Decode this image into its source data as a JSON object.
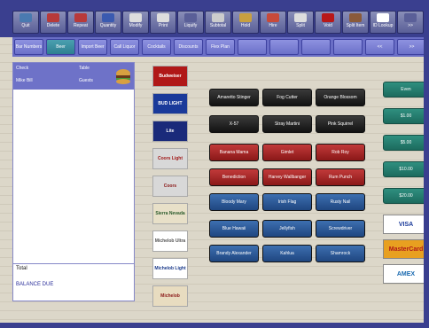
{
  "toolbar": {
    "items": [
      {
        "label": "Quit",
        "color": "#4a7ab0"
      },
      {
        "label": "Delete",
        "color": "#b83a3a"
      },
      {
        "label": "Repeat",
        "color": "#b83a3a"
      },
      {
        "label": "Quantity",
        "color": "#3a5ab0"
      },
      {
        "label": "Modify",
        "color": "#dddddd"
      },
      {
        "label": "Print",
        "color": "#dddddd"
      },
      {
        "label": "Liquify",
        "color": "#5a5f98"
      },
      {
        "label": "Subtotal",
        "color": "#cccccc"
      },
      {
        "label": "Hold",
        "color": "#c8a040"
      },
      {
        "label": "Hire",
        "color": "#c84a3a"
      },
      {
        "label": "Split",
        "color": "#dddddd"
      },
      {
        "label": "Void",
        "color": "#b81818"
      },
      {
        "label": "Split Item",
        "color": "#8a5a3a"
      },
      {
        "label": "ID Lookup",
        "color": "#ffffff"
      },
      {
        "label": ">>",
        "color": "#5a5f98"
      }
    ]
  },
  "nav": {
    "items": [
      {
        "label": "Bar Numbers"
      },
      {
        "label": "Beer",
        "active": true
      },
      {
        "label": "Import Beer"
      },
      {
        "label": "Call Liquor"
      },
      {
        "label": "Cocktails"
      },
      {
        "label": "Discounts"
      },
      {
        "label": "Flex Plan"
      },
      {
        "label": ""
      },
      {
        "label": ""
      },
      {
        "label": ""
      },
      {
        "label": ""
      },
      {
        "label": "<<"
      },
      {
        "label": ">>"
      }
    ]
  },
  "order": {
    "check_label": "Check",
    "table_label": "Table",
    "server": "Mike Bill",
    "guests_label": "Guests",
    "total_label": "Total",
    "balance_label": "BALANCE DUE"
  },
  "beers": [
    {
      "name": "Budweiser",
      "bg": "#b01818",
      "fg": "#ffffff"
    },
    {
      "name": "BUD LIGHT",
      "bg": "#1a3a9a",
      "fg": "#ffffff"
    },
    {
      "name": "Lite",
      "bg": "#1a2a7a",
      "fg": "#ffffff"
    },
    {
      "name": "Coors Light",
      "bg": "#d8d8d8",
      "fg": "#a01818"
    },
    {
      "name": "Coors",
      "bg": "#d8d8d8",
      "fg": "#8a1818"
    },
    {
      "name": "Sierra Nevada",
      "bg": "#e8e0c8",
      "fg": "#2a5a2a"
    },
    {
      "name": "Michelob Ultra",
      "bg": "#ffffff",
      "fg": "#555555"
    },
    {
      "name": "Michelob Light",
      "bg": "#ffffff",
      "fg": "#1a3a8a"
    },
    {
      "name": "Michelob",
      "bg": "#e8dcc0",
      "fg": "#8a1818"
    }
  ],
  "mixers": [
    {
      "label": "Amaretto Stinger",
      "style": "black"
    },
    {
      "label": "Fog Cutter",
      "style": "black"
    },
    {
      "label": "Orange Blossom",
      "style": "black"
    },
    {
      "label": "X-57",
      "style": "black"
    },
    {
      "label": "Stray Martini",
      "style": "black"
    },
    {
      "label": "Pink Squirrel",
      "style": "black"
    },
    {
      "label": "Banana Mama",
      "style": "red"
    },
    {
      "label": "Gimlet",
      "style": "red"
    },
    {
      "label": "Rob Roy",
      "style": "red"
    },
    {
      "label": "Benediction",
      "style": "red"
    },
    {
      "label": "Harvey Wallbanger",
      "style": "red"
    },
    {
      "label": "Rum Punch",
      "style": "red"
    },
    {
      "label": "Bloody Mary",
      "style": "blue"
    },
    {
      "label": "Irish Flag",
      "style": "blue"
    },
    {
      "label": "Rusty Nail",
      "style": "blue"
    },
    {
      "label": "Blue Hawaii",
      "style": "blue"
    },
    {
      "label": "Jellyfish",
      "style": "blue"
    },
    {
      "label": "Screwdriver",
      "style": "blue"
    },
    {
      "label": "Brandy Alexander",
      "style": "blue"
    },
    {
      "label": "Kahlua",
      "style": "blue"
    },
    {
      "label": "Shamrock",
      "style": "blue"
    }
  ],
  "payments": [
    {
      "label": "Even"
    },
    {
      "label": "$1.00"
    },
    {
      "label": "$5.00"
    },
    {
      "label": "$10.00"
    },
    {
      "label": "$20.00"
    }
  ],
  "cards": [
    {
      "label": "VISA",
      "bg": "#ffffff",
      "fg": "#1a3a9a"
    },
    {
      "label": "MasterCard",
      "bg": "#e8a020",
      "fg": "#b01818"
    },
    {
      "label": "AMEX",
      "bg": "#ffffff",
      "fg": "#1a6ab0"
    }
  ]
}
